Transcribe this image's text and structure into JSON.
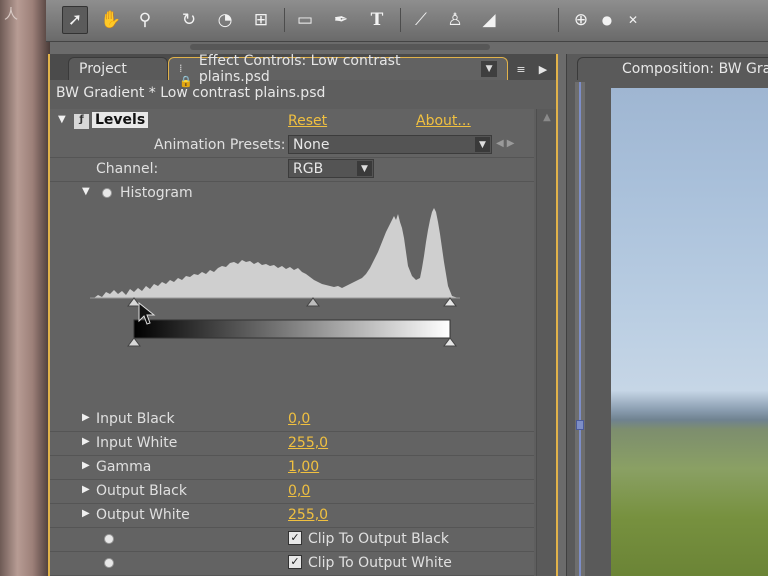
{
  "toolbar": {
    "tools": [
      {
        "name": "selection-tool",
        "glyph": "➚"
      },
      {
        "name": "hand-tool",
        "glyph": "✋"
      },
      {
        "name": "zoom-tool",
        "glyph": "⚲"
      },
      {
        "name": "rotation-tool",
        "glyph": "↻"
      },
      {
        "name": "orbit-camera-tool",
        "glyph": "◔"
      },
      {
        "name": "pan-behind-tool",
        "glyph": "⊞"
      },
      {
        "name": "rectangle-mask-tool",
        "glyph": "▭"
      },
      {
        "name": "pen-tool",
        "glyph": "✒"
      },
      {
        "name": "type-tool",
        "glyph": "T"
      },
      {
        "name": "brush-tool",
        "glyph": "⟋"
      },
      {
        "name": "clone-stamp-tool",
        "glyph": "♙"
      },
      {
        "name": "eraser-tool",
        "glyph": "◢"
      },
      {
        "name": "axis-mode-local",
        "glyph": "⊕"
      },
      {
        "name": "axis-mode-world",
        "glyph": "●"
      },
      {
        "name": "axis-mode-view",
        "glyph": "✕"
      }
    ]
  },
  "tabs": {
    "project": "Project",
    "effect_controls": "Effect Controls: Low contrast plains.psd",
    "composition": "Composition: BW Grad"
  },
  "layer_title": "BW Gradient * Low contrast plains.psd",
  "effect": {
    "fx_glyph": "ƒ",
    "name": "Levels",
    "reset": "Reset",
    "about": "About...",
    "animation_presets_label": "Animation Presets:",
    "animation_presets_value": "None",
    "channel_label": "Channel:",
    "channel_value": "RGB",
    "histogram_label": "Histogram"
  },
  "properties": [
    {
      "label": "Input Black",
      "value": "0,0"
    },
    {
      "label": "Input White",
      "value": "255,0"
    },
    {
      "label": "Gamma",
      "value": "1,00"
    },
    {
      "label": "Output Black",
      "value": "0,0"
    },
    {
      "label": "Output White",
      "value": "255,0"
    }
  ],
  "checkboxes": [
    {
      "label": "Clip To Output Black",
      "checked": "✓"
    },
    {
      "label": "Clip To Output White",
      "checked": "✓"
    }
  ],
  "watermark": "人人素材",
  "colors": {
    "panel_highlight": "#e1b24a",
    "value_link": "#f0c040",
    "histogram_fill": "#cfcfcf"
  }
}
